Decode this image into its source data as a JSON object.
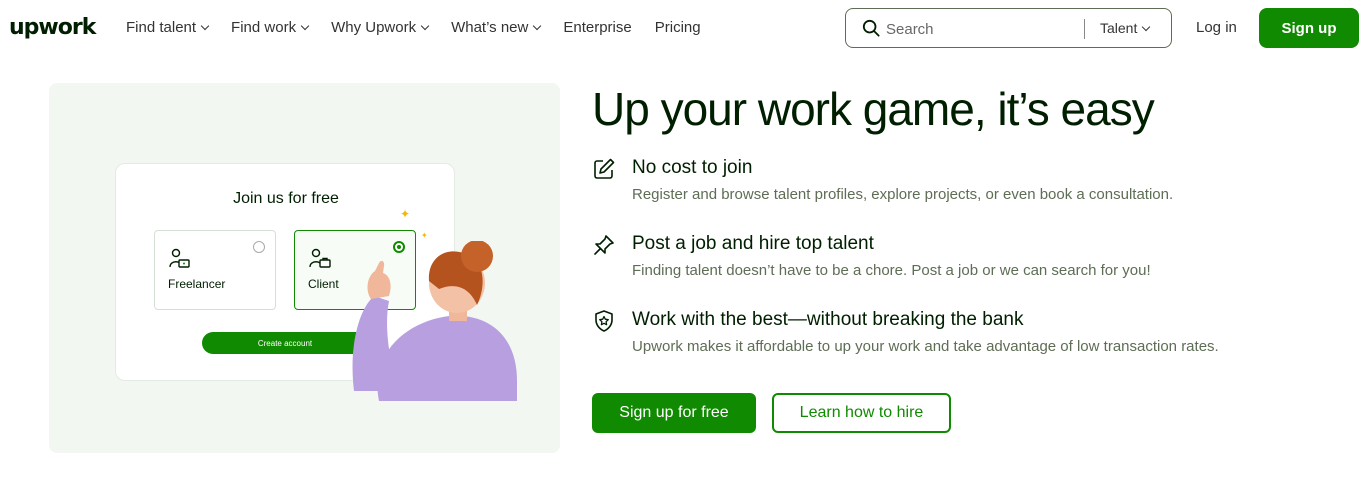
{
  "brand": {
    "logo": "upwork",
    "accent": "#108a00"
  },
  "nav": {
    "links": [
      {
        "label": "Find talent",
        "has_dropdown": true
      },
      {
        "label": "Find work",
        "has_dropdown": true
      },
      {
        "label": "Why Upwork",
        "has_dropdown": true
      },
      {
        "label": "What’s new",
        "has_dropdown": true
      },
      {
        "label": "Enterprise",
        "has_dropdown": false
      },
      {
        "label": "Pricing",
        "has_dropdown": false
      }
    ],
    "search": {
      "placeholder": "Search",
      "scope": "Talent",
      "icon": "search-icon"
    },
    "login_label": "Log in",
    "signup_label": "Sign up"
  },
  "hero_card": {
    "title": "Join us for free",
    "roles": [
      {
        "label": "Freelancer",
        "selected": false,
        "icon": "freelancer-icon"
      },
      {
        "label": "Client",
        "selected": true,
        "icon": "client-icon"
      }
    ],
    "create_label": "Create account"
  },
  "main": {
    "headline": "Up your work game, it’s easy",
    "features": [
      {
        "icon": "pencil-square-icon",
        "title": "No cost to join",
        "desc": "Register and browse talent profiles, explore projects, or even book a consultation."
      },
      {
        "icon": "pin-icon",
        "title": "Post a job and hire top talent",
        "desc": "Finding talent doesn’t have to be a chore. Post a job or we can search for you!"
      },
      {
        "icon": "shield-star-icon",
        "title": "Work with the best—without breaking the bank",
        "desc": "Upwork makes it affordable to up your work and take advantage of low transaction rates."
      }
    ],
    "cta_primary": "Sign up for free",
    "cta_secondary": "Learn how to hire"
  }
}
